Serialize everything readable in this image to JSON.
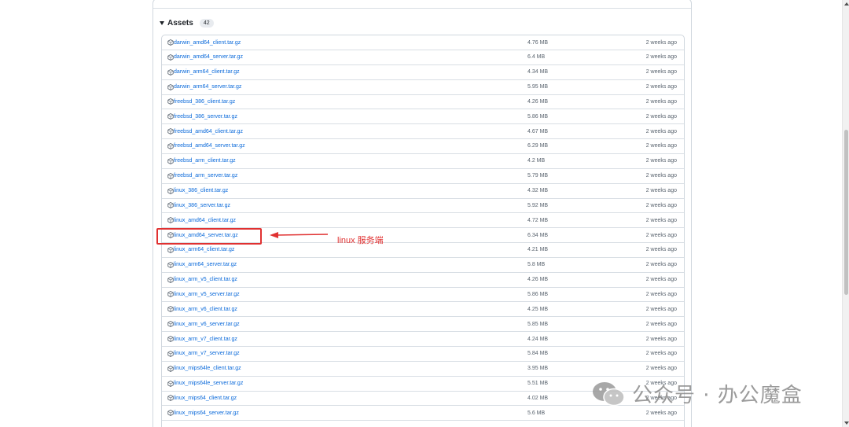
{
  "assets": {
    "title": "Assets",
    "count": "42",
    "rows": [
      {
        "name": "darwin_amd64_client.tar.gz",
        "size": "4.76 MB",
        "date": "2 weeks ago"
      },
      {
        "name": "darwin_amd64_server.tar.gz",
        "size": "6.4 MB",
        "date": "2 weeks ago"
      },
      {
        "name": "darwin_arm64_client.tar.gz",
        "size": "4.34 MB",
        "date": "2 weeks ago"
      },
      {
        "name": "darwin_arm64_server.tar.gz",
        "size": "5.95 MB",
        "date": "2 weeks ago"
      },
      {
        "name": "freebsd_386_client.tar.gz",
        "size": "4.26 MB",
        "date": "2 weeks ago"
      },
      {
        "name": "freebsd_386_server.tar.gz",
        "size": "5.86 MB",
        "date": "2 weeks ago"
      },
      {
        "name": "freebsd_amd64_client.tar.gz",
        "size": "4.67 MB",
        "date": "2 weeks ago"
      },
      {
        "name": "freebsd_amd64_server.tar.gz",
        "size": "6.29 MB",
        "date": "2 weeks ago"
      },
      {
        "name": "freebsd_arm_client.tar.gz",
        "size": "4.2 MB",
        "date": "2 weeks ago"
      },
      {
        "name": "freebsd_arm_server.tar.gz",
        "size": "5.79 MB",
        "date": "2 weeks ago"
      },
      {
        "name": "linux_386_client.tar.gz",
        "size": "4.32 MB",
        "date": "2 weeks ago"
      },
      {
        "name": "linux_386_server.tar.gz",
        "size": "5.92 MB",
        "date": "2 weeks ago"
      },
      {
        "name": "linux_amd64_client.tar.gz",
        "size": "4.72 MB",
        "date": "2 weeks ago"
      },
      {
        "name": "linux_amd64_server.tar.gz",
        "size": "6.34 MB",
        "date": "2 weeks ago"
      },
      {
        "name": "linux_arm64_client.tar.gz",
        "size": "4.21 MB",
        "date": "2 weeks ago"
      },
      {
        "name": "linux_arm64_server.tar.gz",
        "size": "5.8 MB",
        "date": "2 weeks ago"
      },
      {
        "name": "linux_arm_v5_client.tar.gz",
        "size": "4.26 MB",
        "date": "2 weeks ago"
      },
      {
        "name": "linux_arm_v5_server.tar.gz",
        "size": "5.86 MB",
        "date": "2 weeks ago"
      },
      {
        "name": "linux_arm_v6_client.tar.gz",
        "size": "4.25 MB",
        "date": "2 weeks ago"
      },
      {
        "name": "linux_arm_v6_server.tar.gz",
        "size": "5.85 MB",
        "date": "2 weeks ago"
      },
      {
        "name": "linux_arm_v7_client.tar.gz",
        "size": "4.24 MB",
        "date": "2 weeks ago"
      },
      {
        "name": "linux_arm_v7_server.tar.gz",
        "size": "5.84 MB",
        "date": "2 weeks ago"
      },
      {
        "name": "linux_mips64le_client.tar.gz",
        "size": "3.95 MB",
        "date": "2 weeks ago"
      },
      {
        "name": "linux_mips64le_server.tar.gz",
        "size": "5.51 MB",
        "date": "2 weeks ago"
      },
      {
        "name": "linux_mips64_client.tar.gz",
        "size": "4.02 MB",
        "date": "2 weeks ago"
      },
      {
        "name": "linux_mips64_server.tar.gz",
        "size": "5.6 MB",
        "date": "2 weeks ago"
      }
    ]
  },
  "annotation": {
    "text": "linux 服务端",
    "color": "#e03131"
  },
  "watermark": {
    "text": "公众号 · 办公魔盒",
    "icon": "wechat-icon"
  },
  "colors": {
    "link": "#0969da",
    "muted": "#59636e",
    "border": "#d0d7de"
  }
}
